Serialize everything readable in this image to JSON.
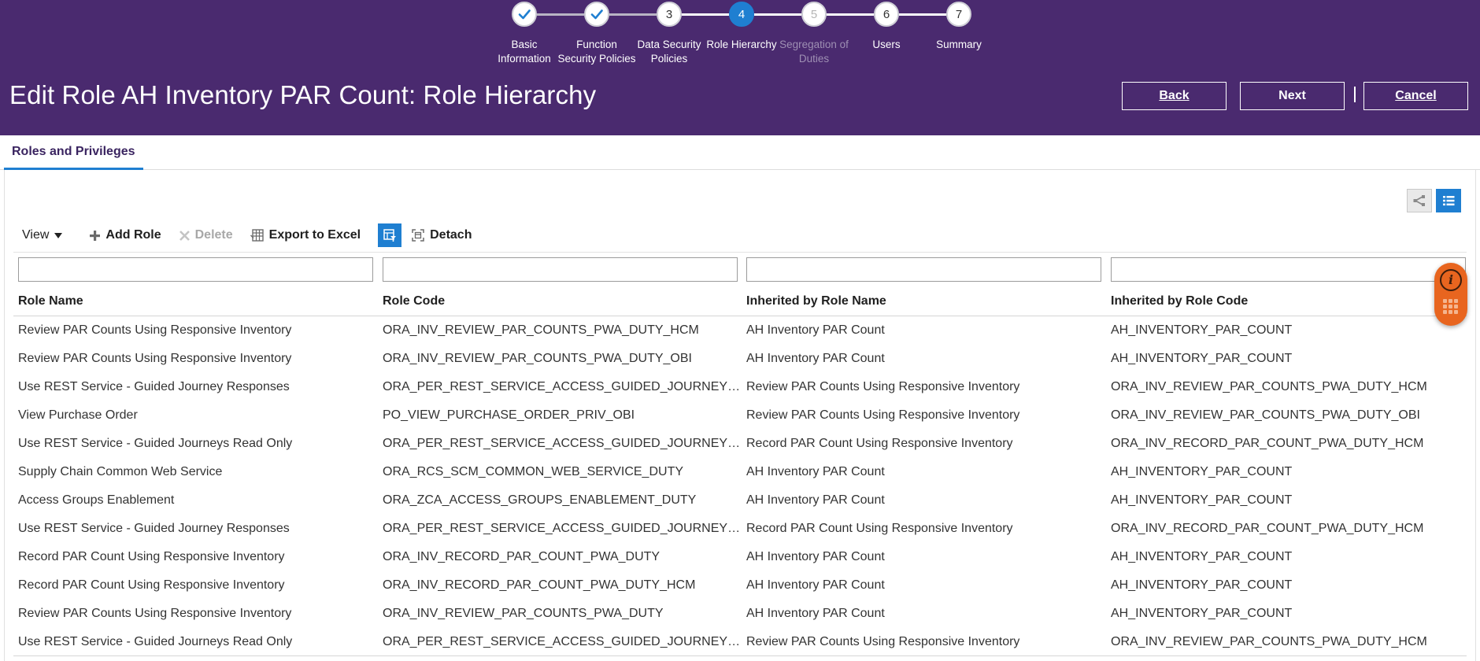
{
  "train": {
    "stops": [
      {
        "number": "",
        "label1": "Basic",
        "label2": "Information",
        "state": "visited"
      },
      {
        "number": "",
        "label1": "Function",
        "label2": "Security Policies",
        "state": "visited"
      },
      {
        "number": "3",
        "label1": "Data Security",
        "label2": "Policies",
        "state": "normal"
      },
      {
        "number": "4",
        "label1": "Role Hierarchy",
        "label2": "",
        "state": "current"
      },
      {
        "number": "5",
        "label1": "Segregation of",
        "label2": "Duties",
        "state": "disabled"
      },
      {
        "number": "6",
        "label1": "Users",
        "label2": "",
        "state": "normal"
      },
      {
        "number": "7",
        "label1": "Summary",
        "label2": "",
        "state": "normal"
      }
    ]
  },
  "header": {
    "title": "Edit Role AH Inventory PAR Count: Role Hierarchy",
    "back_label": "Back",
    "next_label": "Next",
    "cancel_label": "Cancel"
  },
  "tabs": {
    "roles_privileges": "Roles and Privileges"
  },
  "toolbar": {
    "view_label": "View",
    "add_role_label": "Add Role",
    "delete_label": "Delete",
    "export_label": "Export to Excel",
    "detach_label": "Detach"
  },
  "table": {
    "columns": [
      "Role Name",
      "Role Code",
      "Inherited by Role Name",
      "Inherited by Role Code"
    ],
    "rows": [
      [
        "Review PAR Counts Using Responsive Inventory",
        "ORA_INV_REVIEW_PAR_COUNTS_PWA_DUTY_HCM",
        "AH Inventory PAR Count",
        "AH_INVENTORY_PAR_COUNT"
      ],
      [
        "Review PAR Counts Using Responsive Inventory",
        "ORA_INV_REVIEW_PAR_COUNTS_PWA_DUTY_OBI",
        "AH Inventory PAR Count",
        "AH_INVENTORY_PAR_COUNT"
      ],
      [
        "Use REST Service - Guided Journey Responses",
        "ORA_PER_REST_SERVICE_ACCESS_GUIDED_JOURNEY…",
        "Review PAR Counts Using Responsive Inventory",
        "ORA_INV_REVIEW_PAR_COUNTS_PWA_DUTY_HCM"
      ],
      [
        "View Purchase Order",
        "PO_VIEW_PURCHASE_ORDER_PRIV_OBI",
        "Review PAR Counts Using Responsive Inventory",
        "ORA_INV_REVIEW_PAR_COUNTS_PWA_DUTY_OBI"
      ],
      [
        "Use REST Service - Guided Journeys Read Only",
        "ORA_PER_REST_SERVICE_ACCESS_GUIDED_JOURNEY…",
        "Record PAR Count Using Responsive Inventory",
        "ORA_INV_RECORD_PAR_COUNT_PWA_DUTY_HCM"
      ],
      [
        "Supply Chain Common Web Service",
        "ORA_RCS_SCM_COMMON_WEB_SERVICE_DUTY",
        "AH Inventory PAR Count",
        "AH_INVENTORY_PAR_COUNT"
      ],
      [
        "Access Groups Enablement",
        "ORA_ZCA_ACCESS_GROUPS_ENABLEMENT_DUTY",
        "AH Inventory PAR Count",
        "AH_INVENTORY_PAR_COUNT"
      ],
      [
        "Use REST Service - Guided Journey Responses",
        "ORA_PER_REST_SERVICE_ACCESS_GUIDED_JOURNEY…",
        "Record PAR Count Using Responsive Inventory",
        "ORA_INV_RECORD_PAR_COUNT_PWA_DUTY_HCM"
      ],
      [
        "Record PAR Count Using Responsive Inventory",
        "ORA_INV_RECORD_PAR_COUNT_PWA_DUTY",
        "AH Inventory PAR Count",
        "AH_INVENTORY_PAR_COUNT"
      ],
      [
        "Record PAR Count Using Responsive Inventory",
        "ORA_INV_RECORD_PAR_COUNT_PWA_DUTY_HCM",
        "AH Inventory PAR Count",
        "AH_INVENTORY_PAR_COUNT"
      ],
      [
        "Review PAR Counts Using Responsive Inventory",
        "ORA_INV_REVIEW_PAR_COUNTS_PWA_DUTY",
        "AH Inventory PAR Count",
        "AH_INVENTORY_PAR_COUNT"
      ],
      [
        "Use REST Service - Guided Journeys Read Only",
        "ORA_PER_REST_SERVICE_ACCESS_GUIDED_JOURNEY…",
        "Review PAR Counts Using Responsive Inventory",
        "ORA_INV_REVIEW_PAR_COUNTS_PWA_DUTY_HCM"
      ]
    ]
  },
  "icons": {
    "visited_stop": "checkmark-icon",
    "add": "plus-icon",
    "delete": "x-icon",
    "export": "spreadsheet-icon",
    "qbe": "query-by-example-icon",
    "detach": "detach-icon",
    "hierarchy_view": "hierarchy-icon",
    "list_view": "list-icon",
    "info": "info-icon",
    "grid": "grid-dots-icon"
  },
  "colors": {
    "header_bg": "#4a2a6f",
    "accent": "#1f7fd1",
    "floating": "#e8651f"
  }
}
